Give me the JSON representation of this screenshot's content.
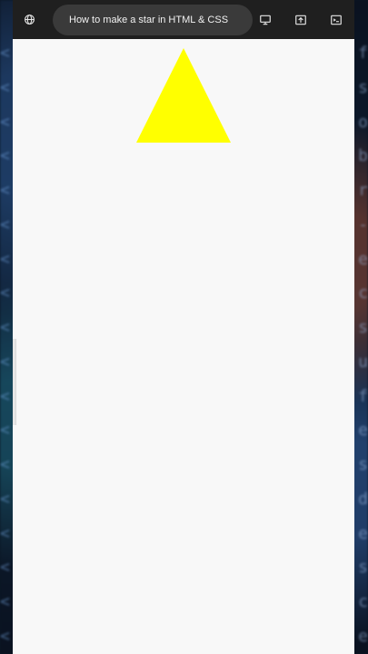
{
  "browser": {
    "tab_title": "How to make a star in HTML & CSS",
    "icons": {
      "site_info": "globe-icon",
      "desktop": "monitor-icon",
      "share": "share-icon",
      "devtools": "terminal-icon"
    }
  },
  "page": {
    "shape": "triangle",
    "shape_color": "#ffff00",
    "background_color": "#f8f8f8"
  }
}
